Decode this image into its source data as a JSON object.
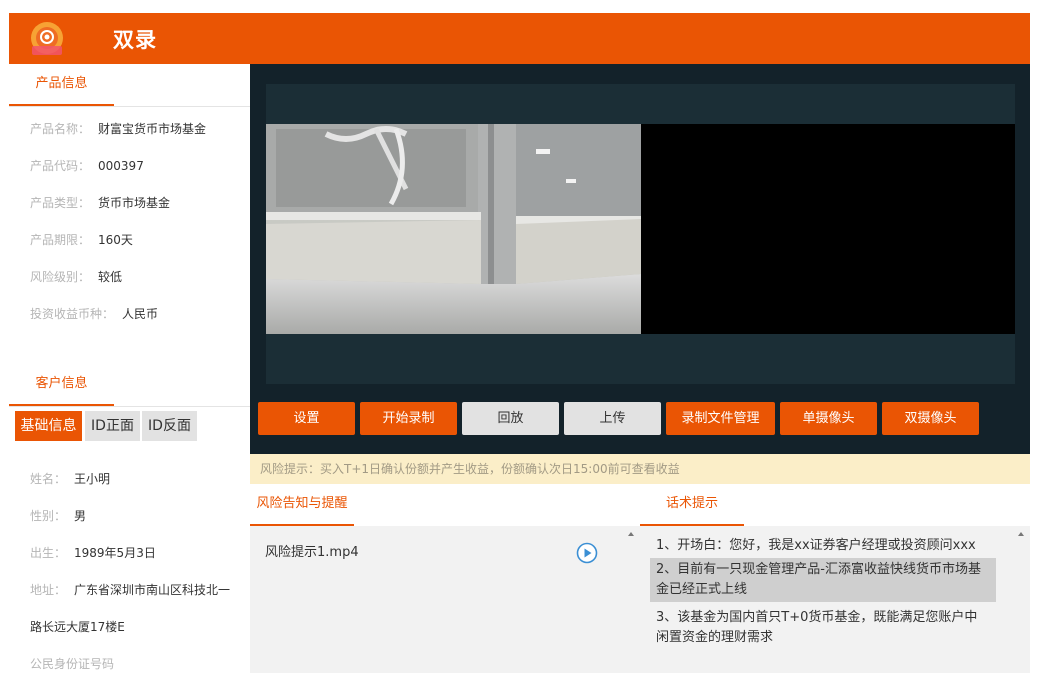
{
  "app": {
    "title": "双录"
  },
  "product": {
    "section_title": "产品信息",
    "fields": [
      {
        "key": "产品名称：",
        "value": "财富宝货币市场基金"
      },
      {
        "key": "产品代码：",
        "value": "000397"
      },
      {
        "key": "产品类型：",
        "value": "货币市场基金"
      },
      {
        "key": "产品期限：",
        "value": "160天"
      },
      {
        "key": "风险级别：",
        "value": "较低"
      },
      {
        "key": "投资收益币种：",
        "value": "人民币"
      }
    ]
  },
  "customer": {
    "section_title": "客户信息",
    "tabs": [
      "基础信息",
      "ID正面",
      "ID反面"
    ],
    "fields": [
      {
        "key": "姓名：",
        "value": "王小明"
      },
      {
        "key": "性别：",
        "value": "男"
      },
      {
        "key": "出生：",
        "value": "1989年5月3日"
      },
      {
        "key": "地址：",
        "value": "广东省深圳市南山区科技北一"
      }
    ],
    "address_cont": "路长远大厦17楼E",
    "id_label": "公民身份证号码"
  },
  "toolbar": {
    "buttons": [
      "设置",
      "开始录制",
      "回放",
      "上传",
      "录制文件管理",
      "单摄像头",
      "双摄像头"
    ]
  },
  "risk_tip": "风险提示：买入T+1日确认份额并产生收益，份额确认次日15:00前可查看收益",
  "lower": {
    "left_tab": "风险告知与提醒",
    "right_tab": "话术提示",
    "file_name": "风险提示1.mp4",
    "scripts": [
      "1、开场白：您好，我是xx证券客户经理或投资顾问xxx",
      "2、目前有一只现金管理产品-汇添富收益快线货币市场基金已经正式上线",
      "3、该基金为国内首只T+0货币基金，既能满足您账户中闲置资金的理财需求"
    ]
  },
  "colors": {
    "accent": "#ea5504",
    "video_bg": "#13222a",
    "tip_bg": "#fbeec8"
  },
  "icons": {
    "logo": "camera-logo-icon",
    "play": "play-circle-icon",
    "scroll_up": "scroll-up-arrow-icon"
  }
}
